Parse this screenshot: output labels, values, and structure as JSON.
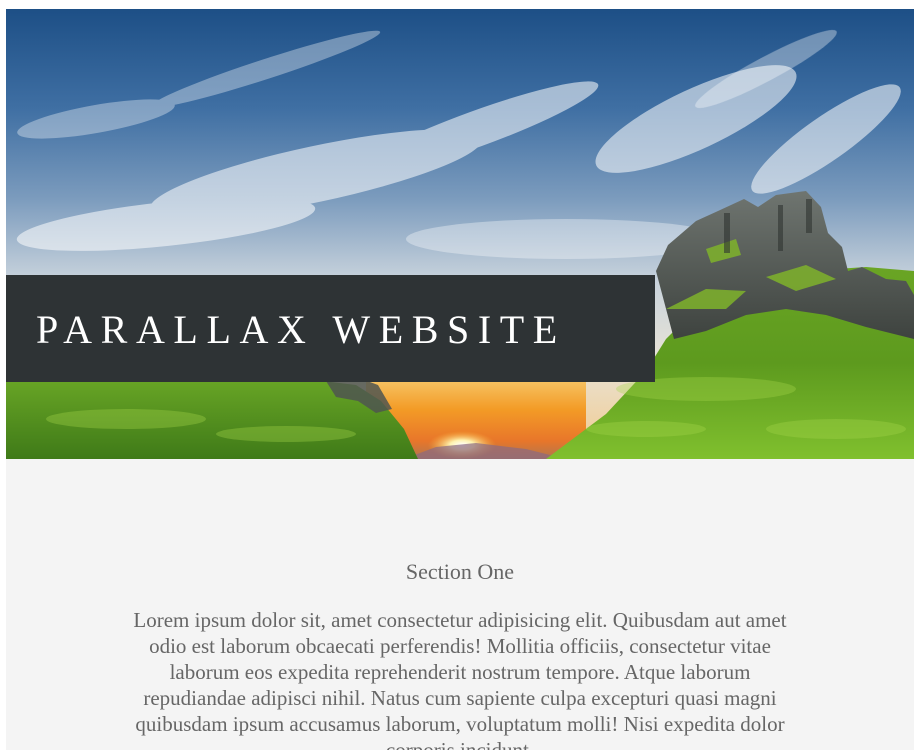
{
  "hero": {
    "title": "PARALLAX WEBSITE",
    "image": "landscape-photo-sunset-cliffs",
    "colors": {
      "sky_top": "#1d4f86",
      "sky_mid": "#5c86b2",
      "sky_light": "#dfe4e6",
      "sunset": "#f39b26",
      "grass": "#5d9a1e",
      "rock": "#4d524e",
      "banner": "#2e3335"
    }
  },
  "section_one": {
    "heading": "Section One",
    "body": "Lorem ipsum dolor sit, amet consectetur adipisicing elit. Quibusdam aut amet odio est laborum obcaecati perferendis! Mollitia officiis, consectetur vitae laborum eos expedita reprehenderit nostrum tempore. Atque laborum repudiandae adipisci nihil. Natus cum sapiente culpa excepturi quasi magni quibusdam ipsum accusamus laborum, voluptatum molli! Nisi expedita dolor corporis incidunt."
  }
}
